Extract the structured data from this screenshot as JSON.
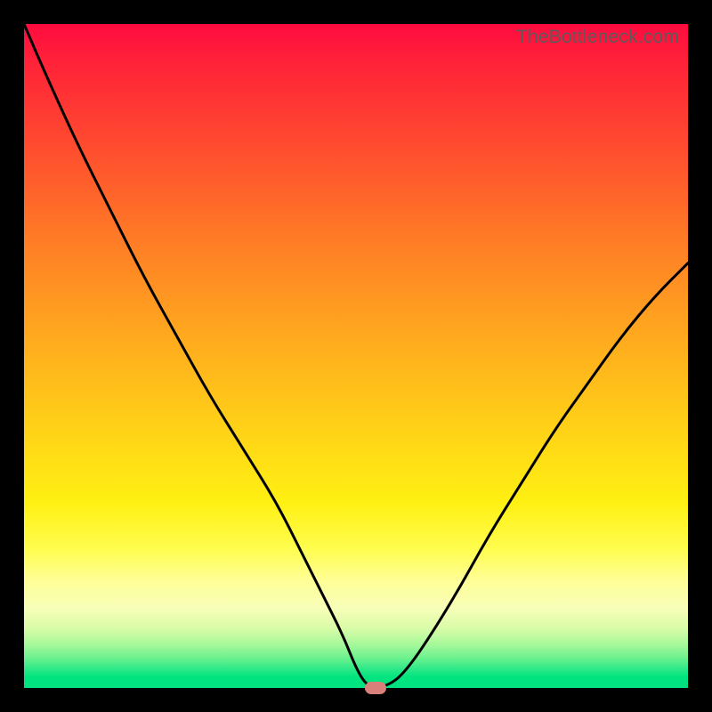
{
  "watermark": "TheBottleneck.com",
  "colors": {
    "page_bg": "#000000",
    "gradient_top": "#ff0b3f",
    "gradient_mid": "#ffe812",
    "gradient_bottom": "#00e281",
    "curve": "#000000",
    "marker": "#d9807a"
  },
  "chart_data": {
    "type": "line",
    "title": "",
    "xlabel": "",
    "ylabel": "",
    "xlim": [
      0,
      100
    ],
    "ylim": [
      0,
      100
    ],
    "x": [
      0,
      3,
      8,
      13,
      18,
      23,
      28,
      33,
      38,
      42,
      45,
      48,
      50,
      51.5,
      53,
      55,
      57,
      60,
      65,
      70,
      75,
      80,
      85,
      90,
      95,
      100
    ],
    "values": [
      100,
      93,
      82,
      72,
      62,
      53,
      44,
      36,
      28,
      20,
      14,
      8,
      3,
      0.5,
      0,
      0.5,
      2,
      6,
      14,
      23,
      31,
      39,
      46,
      53,
      59,
      64
    ],
    "flat_bottom_range": [
      51,
      55
    ],
    "marker": {
      "x": 53,
      "y": 0
    },
    "note": "Values read from pixel positions; axes have no tick labels so units are percent of plot extent. Curve is a steep V with slightly curved arms and a short flat segment at the minimum around x≈51–55."
  }
}
